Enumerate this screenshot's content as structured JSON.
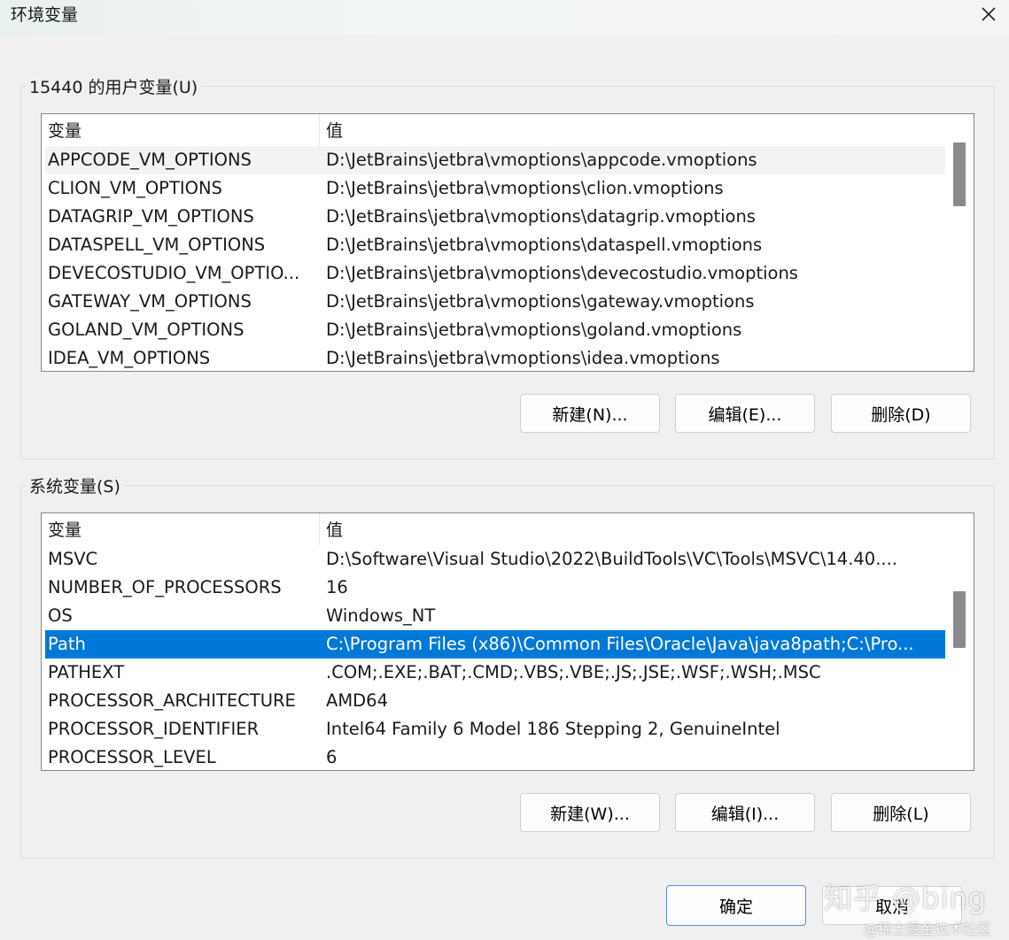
{
  "window": {
    "title": "环境变量",
    "close_icon": "close-icon"
  },
  "user_vars": {
    "label": "15440 的用户变量(U)",
    "columns": [
      "变量",
      "值"
    ],
    "rows": [
      {
        "name": "APPCODE_VM_OPTIONS",
        "value": "D:\\JetBrains\\jetbra\\vmoptions\\appcode.vmoptions"
      },
      {
        "name": "CLION_VM_OPTIONS",
        "value": "D:\\JetBrains\\jetbra\\vmoptions\\clion.vmoptions"
      },
      {
        "name": "DATAGRIP_VM_OPTIONS",
        "value": "D:\\JetBrains\\jetbra\\vmoptions\\datagrip.vmoptions"
      },
      {
        "name": "DATASPELL_VM_OPTIONS",
        "value": "D:\\JetBrains\\jetbra\\vmoptions\\dataspell.vmoptions"
      },
      {
        "name": "DEVECOSTUDIO_VM_OPTIO...",
        "value": "D:\\JetBrains\\jetbra\\vmoptions\\devecostudio.vmoptions"
      },
      {
        "name": "GATEWAY_VM_OPTIONS",
        "value": "D:\\JetBrains\\jetbra\\vmoptions\\gateway.vmoptions"
      },
      {
        "name": "GOLAND_VM_OPTIONS",
        "value": "D:\\JetBrains\\jetbra\\vmoptions\\goland.vmoptions"
      },
      {
        "name": "IDEA_VM_OPTIONS",
        "value": "D:\\JetBrains\\jetbra\\vmoptions\\idea.vmoptions"
      }
    ],
    "buttons": {
      "new": "新建(N)...",
      "edit": "编辑(E)...",
      "delete": "删除(D)"
    }
  },
  "system_vars": {
    "label": "系统变量(S)",
    "columns": [
      "变量",
      "值"
    ],
    "rows": [
      {
        "name": "MSVC",
        "value": "D:\\Software\\Visual Studio\\2022\\BuildTools\\VC\\Tools\\MSVC\\14.40...."
      },
      {
        "name": "NUMBER_OF_PROCESSORS",
        "value": "16"
      },
      {
        "name": "OS",
        "value": "Windows_NT"
      },
      {
        "name": "Path",
        "value": "C:\\Program Files (x86)\\Common Files\\Oracle\\Java\\java8path;C:\\Pro..."
      },
      {
        "name": "PATHEXT",
        "value": ".COM;.EXE;.BAT;.CMD;.VBS;.VBE;.JS;.JSE;.WSF;.WSH;.MSC"
      },
      {
        "name": "PROCESSOR_ARCHITECTURE",
        "value": "AMD64"
      },
      {
        "name": "PROCESSOR_IDENTIFIER",
        "value": "Intel64 Family 6 Model 186 Stepping 2, GenuineIntel"
      },
      {
        "name": "PROCESSOR_LEVEL",
        "value": "6"
      }
    ],
    "buttons": {
      "new": "新建(W)...",
      "edit": "编辑(I)...",
      "delete": "删除(L)"
    }
  },
  "footer": {
    "ok": "确定",
    "cancel": "取消"
  },
  "watermark": {
    "main": "知乎 @bing",
    "sub": "@稀土掘金技术社区"
  },
  "colors": {
    "selection": "#0078d7",
    "accent_border": "#5b8bd1"
  }
}
